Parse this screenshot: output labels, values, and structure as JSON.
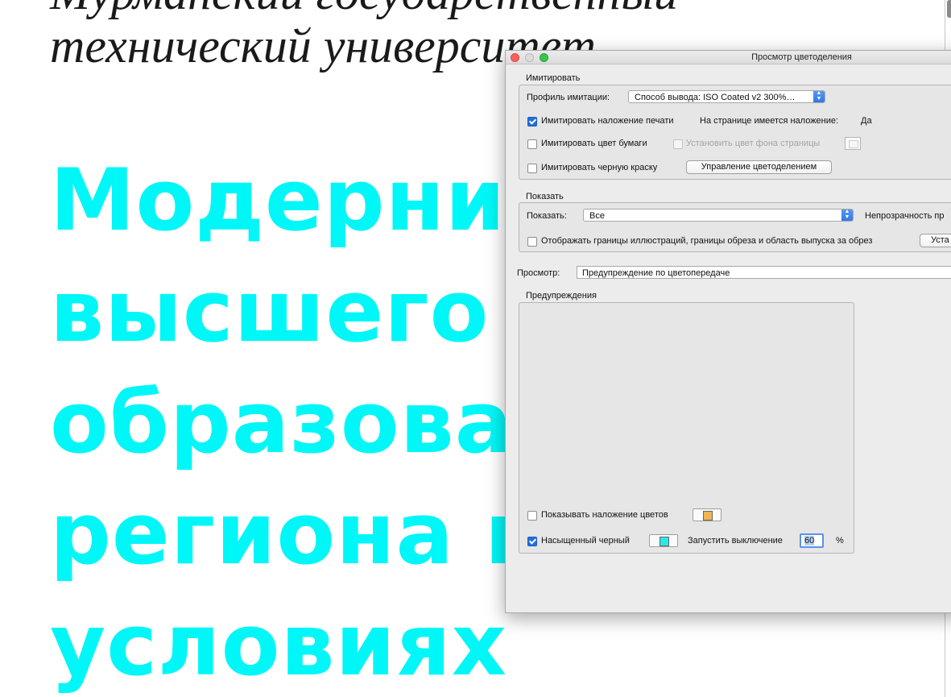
{
  "document": {
    "subtitle_line1": "Мурманский государственный",
    "subtitle_line2": "технический университет",
    "heading_lines": [
      "Модерниз",
      "высшего",
      "образован",
      "региона  в",
      "условиях"
    ],
    "heading_color": "#00f7f7"
  },
  "dialog": {
    "title": "Просмотр цветоделения",
    "simulate": {
      "group_label": "Имитировать",
      "profile_label": "Профиль имитации:",
      "profile_value": "Способ вывода: ISO Coated v2 300%…",
      "overprint_label": "Имитировать наложение печати",
      "overprint_checked": true,
      "page_overprint_label": "На странице имеется наложение:",
      "page_overprint_value": "Да",
      "paper_color_label": "Имитировать цвет бумаги",
      "paper_color_checked": false,
      "page_bg_label": "Установить цвет фона страницы",
      "page_bg_checked": false,
      "black_ink_label": "Имитировать черную краску",
      "black_ink_checked": false,
      "manage_button": "Управление цветоделением"
    },
    "show": {
      "group_label": "Показать",
      "show_label": "Показать:",
      "show_value": "Все",
      "opacity_label": "Непрозрачность пр",
      "boundaries_label": "Отображать границы иллюстраций, границы обреза и область выпуска за обрез",
      "boundaries_checked": false,
      "setup_button": "Уста"
    },
    "preview": {
      "label": "Просмотр:",
      "value": "Предупреждение по цветопередаче"
    },
    "warnings": {
      "group_label": "Предупреждения",
      "show_overprint_label": "Показывать наложение цветов",
      "show_overprint_checked": false,
      "overprint_swatch_color": "#f0b450",
      "rich_black_label": "Насыщенный черный",
      "rich_black_checked": true,
      "rich_black_swatch_color": "#2ee8e8",
      "start_cutoff_label": "Запустить выключение",
      "start_cutoff_value": "60",
      "percent_sign": "%"
    }
  },
  "icons": {
    "close": "close-icon",
    "minimize": "minimize-icon",
    "zoom": "zoom-icon",
    "dropdown": "chevron-updown-icon"
  },
  "colors": {
    "close": "#fc605c",
    "zoom": "#34c84a",
    "accent": "#1f6fe0"
  }
}
